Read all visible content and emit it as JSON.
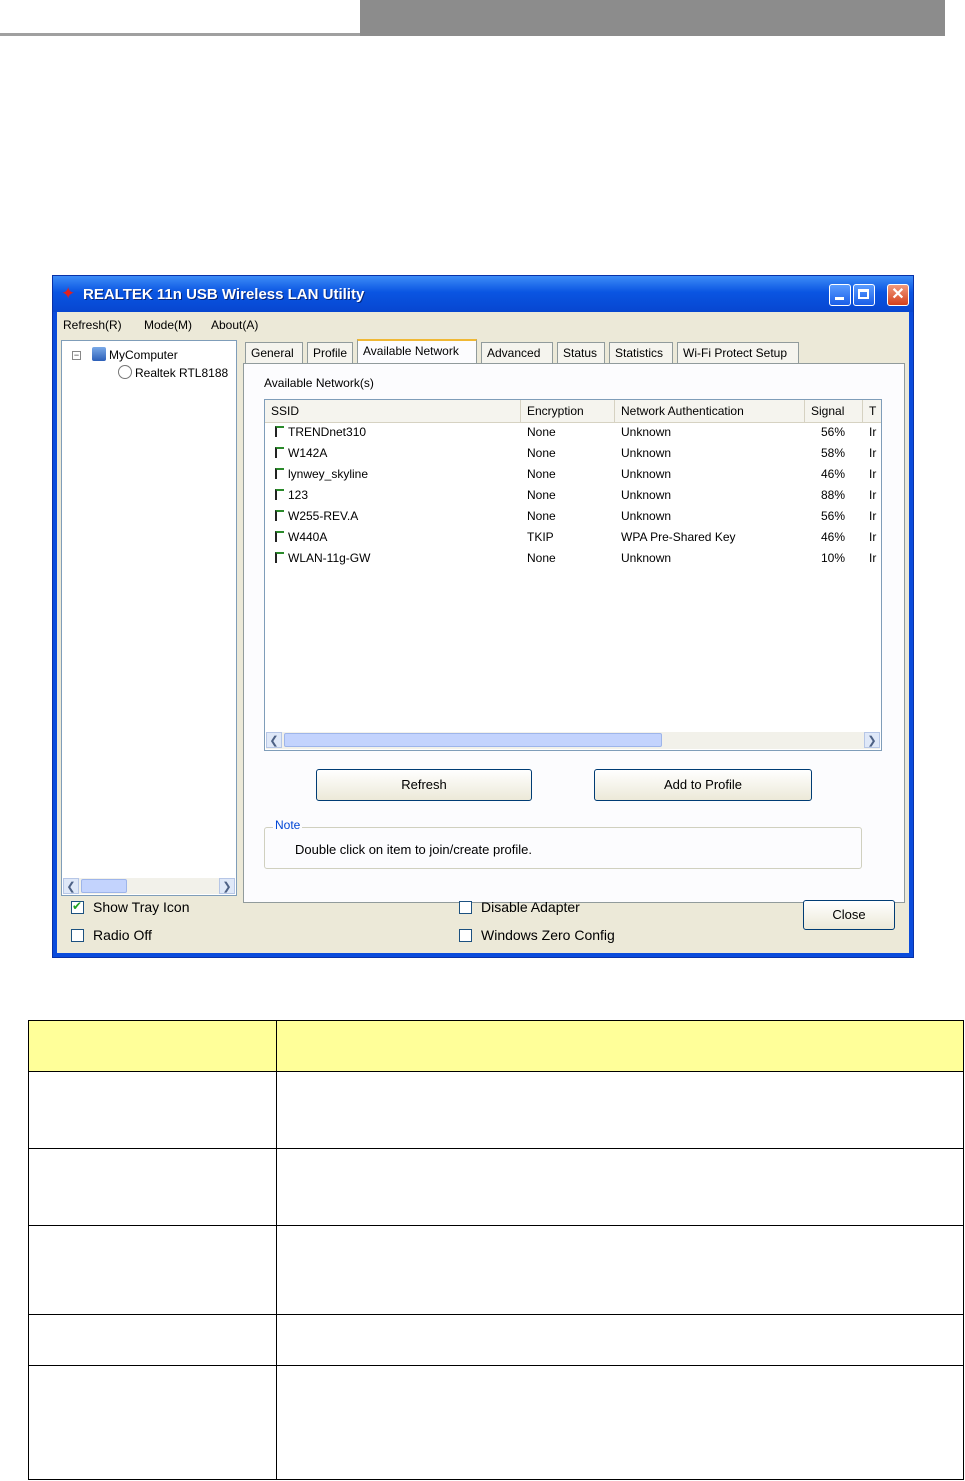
{
  "window": {
    "title": "REALTEK 11n USB Wireless LAN Utility",
    "title_color": "#0a4bdc"
  },
  "menu": [
    "Refresh(R)",
    "Mode(M)",
    "About(A)"
  ],
  "tree": {
    "root": "MyComputer",
    "child": "Realtek RTL8188"
  },
  "tabs": [
    "General",
    "Profile",
    "Available Network",
    "Advanced",
    "Status",
    "Statistics",
    "Wi-Fi Protect Setup"
  ],
  "active_tab": "Available Network",
  "available_network": {
    "label": "Available Network(s)",
    "columns": [
      "SSID",
      "Encryption",
      "Network Authentication",
      "Signal",
      "T"
    ],
    "rows": [
      {
        "ssid": "TRENDnet310",
        "encryption": "None",
        "auth": "Unknown",
        "signal": "56%",
        "type": "Ir"
      },
      {
        "ssid": "W142A",
        "encryption": "None",
        "auth": "Unknown",
        "signal": "58%",
        "type": "Ir"
      },
      {
        "ssid": "lynwey_skyline",
        "encryption": "None",
        "auth": "Unknown",
        "signal": "46%",
        "type": "Ir"
      },
      {
        "ssid": "123",
        "encryption": "None",
        "auth": "Unknown",
        "signal": "88%",
        "type": "Ir"
      },
      {
        "ssid": "W255-REV.A",
        "encryption": "None",
        "auth": "Unknown",
        "signal": "56%",
        "type": "Ir"
      },
      {
        "ssid": "W440A",
        "encryption": "TKIP",
        "auth": "WPA Pre-Shared Key",
        "signal": "46%",
        "type": "Ir"
      },
      {
        "ssid": "WLAN-11g-GW",
        "encryption": "None",
        "auth": "Unknown",
        "signal": "10%",
        "type": "Ir"
      }
    ],
    "buttons": {
      "refresh": "Refresh",
      "add_to_profile": "Add to Profile"
    },
    "note_title": "Note",
    "note_text": "Double click on item to join/create profile."
  },
  "bottom": {
    "show_tray_icon": "Show Tray Icon",
    "show_tray_icon_checked": true,
    "radio_off": "Radio Off",
    "radio_off_checked": false,
    "disable_adapter": "Disable Adapter",
    "disable_adapter_checked": false,
    "windows_zero_config": "Windows Zero Config",
    "windows_zero_config_checked": false,
    "close": "Close"
  },
  "table": {
    "header_color": "#ffff99"
  }
}
